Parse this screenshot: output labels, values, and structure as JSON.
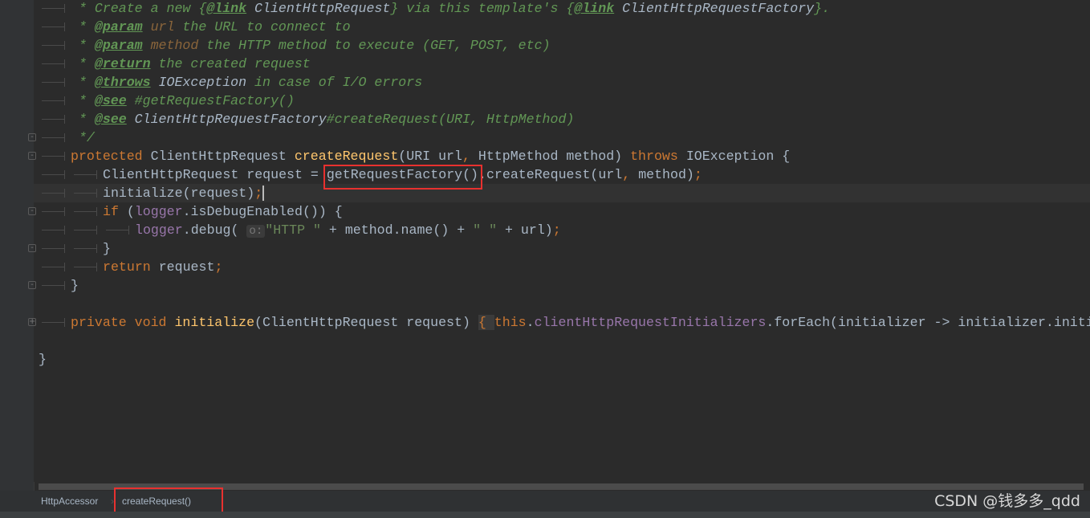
{
  "editor": {
    "lines": [
      {
        "indent": 1,
        "tokens": [
          [
            "cm",
            " * Create a new {"
          ],
          [
            "tag",
            "@link"
          ],
          [
            "cref",
            " ClientHttpRequest"
          ],
          [
            "cm",
            "} via this template's {"
          ],
          [
            "tag",
            "@link"
          ],
          [
            "cref",
            " ClientHttpRequestFactory"
          ],
          [
            "cm",
            "}."
          ]
        ]
      },
      {
        "indent": 1,
        "tokens": [
          [
            "cm",
            " * "
          ],
          [
            "tag",
            "@param"
          ],
          [
            "pn",
            " url"
          ],
          [
            "cm",
            " the URL to connect to"
          ]
        ]
      },
      {
        "indent": 1,
        "tokens": [
          [
            "cm",
            " * "
          ],
          [
            "tag",
            "@param"
          ],
          [
            "pn",
            " method"
          ],
          [
            "cm",
            " the HTTP method to execute (GET, POST, etc)"
          ]
        ]
      },
      {
        "indent": 1,
        "tokens": [
          [
            "cm",
            " * "
          ],
          [
            "tag",
            "@return"
          ],
          [
            "cm",
            " the created request"
          ]
        ]
      },
      {
        "indent": 1,
        "tokens": [
          [
            "cm",
            " * "
          ],
          [
            "tag",
            "@throws"
          ],
          [
            "cref",
            " IOException"
          ],
          [
            "cm",
            " in case of I/O errors"
          ]
        ]
      },
      {
        "indent": 1,
        "tokens": [
          [
            "cm",
            " * "
          ],
          [
            "tag",
            "@see"
          ],
          [
            "cm",
            " #getRequestFactory()"
          ]
        ]
      },
      {
        "indent": 1,
        "tokens": [
          [
            "cm",
            " * "
          ],
          [
            "tag",
            "@see"
          ],
          [
            "cref",
            " ClientHttpRequestFactory"
          ],
          [
            "cm",
            "#createRequest(URI, HttpMethod)"
          ]
        ]
      },
      {
        "indent": 1,
        "fold": "-",
        "tokens": [
          [
            "cm",
            " */"
          ]
        ]
      },
      {
        "indent": 1,
        "fold": "-",
        "tokens": [
          [
            "kw",
            "protected "
          ],
          [
            "ty",
            "ClientHttpRequest "
          ],
          [
            "md",
            "createRequest"
          ],
          [
            "ty",
            "(URI url"
          ],
          [
            "kw",
            ", "
          ],
          [
            "ty",
            "HttpMethod method) "
          ],
          [
            "kw",
            "throws "
          ],
          [
            "ty",
            "IOException {"
          ]
        ]
      },
      {
        "indent": 2,
        "tokens": [
          [
            "ty",
            "ClientHttpRequest request = getRequestFactory().createRequest(url"
          ],
          [
            "kw",
            ", "
          ],
          [
            "ty",
            "method)"
          ],
          [
            "kw",
            ";"
          ]
        ]
      },
      {
        "indent": 2,
        "current": true,
        "tokens": [
          [
            "ty",
            "initialize(request)"
          ],
          [
            "kw caret",
            ";"
          ]
        ]
      },
      {
        "indent": 2,
        "fold": "-",
        "tokens": [
          [
            "kw",
            "if "
          ],
          [
            "ty",
            "("
          ],
          [
            "fd",
            "logger"
          ],
          [
            "ty",
            ".isDebugEnabled()) {"
          ]
        ]
      },
      {
        "indent": 3,
        "tokens": [
          [
            "fd",
            "logger"
          ],
          [
            "ty",
            ".debug( "
          ],
          [
            "hint",
            "o:"
          ],
          [
            "st",
            "\"HTTP \""
          ],
          [
            "ty",
            " + method.name() + "
          ],
          [
            "st",
            "\" \""
          ],
          [
            "ty",
            " + url)"
          ],
          [
            "kw",
            ";"
          ]
        ]
      },
      {
        "indent": 2,
        "fold": "-",
        "tokens": [
          [
            "ty",
            "}"
          ]
        ]
      },
      {
        "indent": 2,
        "tokens": [
          [
            "kw",
            "return "
          ],
          [
            "ty",
            "request"
          ],
          [
            "kw",
            ";"
          ]
        ]
      },
      {
        "indent": 1,
        "fold": "-",
        "tokens": [
          [
            "ty",
            "}"
          ]
        ]
      },
      {
        "indent": 0,
        "tokens": []
      },
      {
        "indent": 1,
        "fold": "+",
        "tokens": [
          [
            "kw",
            "private void "
          ],
          [
            "md",
            "initialize"
          ],
          [
            "ty",
            "(ClientHttpRequest request) "
          ],
          [
            "kw brace",
            "{ "
          ],
          [
            "kw",
            "this"
          ],
          [
            "ty",
            "."
          ],
          [
            "fd",
            "clientHttpRequestInitializers"
          ],
          [
            "ty",
            ".forEach(initializer -> initializer.initialize(request))"
          ],
          [
            "kw",
            ";"
          ],
          [
            "ty",
            " }"
          ]
        ]
      },
      {
        "indent": 0,
        "tokens": []
      },
      {
        "indent": 0,
        "tokens": [
          [
            "ty",
            "}"
          ]
        ]
      }
    ]
  },
  "breadcrumb": {
    "items": [
      "HttpAccessor",
      "createRequest()"
    ]
  },
  "watermark": "CSDN @钱多多_qdd",
  "colors": {
    "keyword": "#cc7832",
    "method": "#ffc66d",
    "doc_comment": "#629755",
    "field": "#9876aa",
    "string": "#6a8759",
    "highlight_box": "#e8312f"
  }
}
